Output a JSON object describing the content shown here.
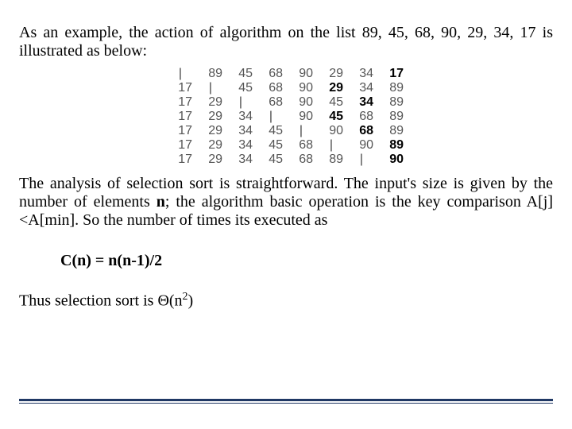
{
  "para1": "As an example, the action of algorithm on the list 89, 45, 68, 90, 29, 34, 17 is illustrated as below:",
  "trace": {
    "rows": [
      {
        "sorted": [],
        "sep": "|",
        "unsorted": [
          "89",
          "45",
          "68",
          "90",
          "29",
          "34"
        ],
        "bold": "17"
      },
      {
        "sorted": [
          "17"
        ],
        "sep": "|",
        "unsorted": [
          "45",
          "68",
          "90"
        ],
        "bold": "29",
        "tail": [
          "34",
          "89"
        ]
      },
      {
        "sorted": [
          "17",
          "29"
        ],
        "sep": "|",
        "unsorted": [
          "68",
          "90",
          "45"
        ],
        "bold": "34",
        "tail": [
          "89"
        ]
      },
      {
        "sorted": [
          "17",
          "29",
          "34"
        ],
        "sep": "|",
        "unsorted": [
          "90"
        ],
        "bold": "45",
        "tail": [
          "68",
          "89"
        ]
      },
      {
        "sorted": [
          "17",
          "29",
          "34",
          "45"
        ],
        "sep": "|",
        "unsorted": [
          "90"
        ],
        "bold": "68",
        "tail": [
          "89"
        ]
      },
      {
        "sorted": [
          "17",
          "29",
          "34",
          "45",
          "68"
        ],
        "sep": "|",
        "unsorted": [
          "90"
        ],
        "bold": "89",
        "tail": []
      },
      {
        "sorted": [
          "17",
          "29",
          "34",
          "45",
          "68",
          "89"
        ],
        "sep": "|",
        "unsorted": [],
        "bold": "90",
        "tail": []
      }
    ]
  },
  "para2_parts": {
    "a": "The analysis of selection sort is straightforward. The input's size is given by the number of elements ",
    "n": "n",
    "b": "; the algorithm basic operation is the key comparison A[j]<A[min]. So the number of times its executed as"
  },
  "formula": "C(n) = n(n-1)/2",
  "para3_parts": {
    "a": "Thus selection sort is ",
    "theta": "Θ(n",
    "exp": "2",
    "close": ")"
  }
}
